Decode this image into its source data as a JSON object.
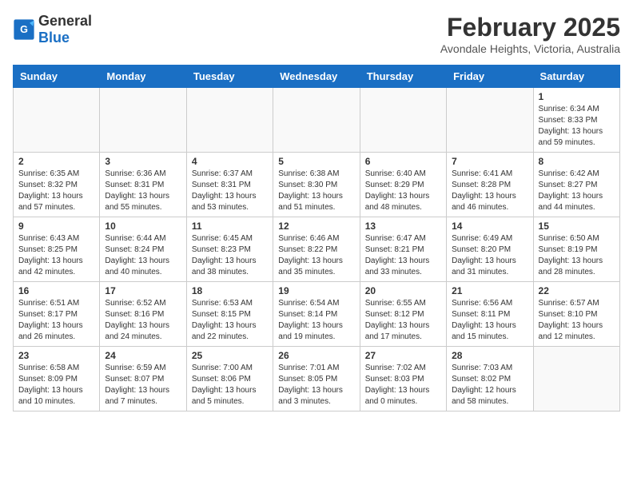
{
  "header": {
    "logo_general": "General",
    "logo_blue": "Blue",
    "month": "February 2025",
    "location": "Avondale Heights, Victoria, Australia"
  },
  "weekdays": [
    "Sunday",
    "Monday",
    "Tuesday",
    "Wednesday",
    "Thursday",
    "Friday",
    "Saturday"
  ],
  "weeks": [
    [
      {
        "day": "",
        "info": ""
      },
      {
        "day": "",
        "info": ""
      },
      {
        "day": "",
        "info": ""
      },
      {
        "day": "",
        "info": ""
      },
      {
        "day": "",
        "info": ""
      },
      {
        "day": "",
        "info": ""
      },
      {
        "day": "1",
        "info": "Sunrise: 6:34 AM\nSunset: 8:33 PM\nDaylight: 13 hours and 59 minutes."
      }
    ],
    [
      {
        "day": "2",
        "info": "Sunrise: 6:35 AM\nSunset: 8:32 PM\nDaylight: 13 hours and 57 minutes."
      },
      {
        "day": "3",
        "info": "Sunrise: 6:36 AM\nSunset: 8:31 PM\nDaylight: 13 hours and 55 minutes."
      },
      {
        "day": "4",
        "info": "Sunrise: 6:37 AM\nSunset: 8:31 PM\nDaylight: 13 hours and 53 minutes."
      },
      {
        "day": "5",
        "info": "Sunrise: 6:38 AM\nSunset: 8:30 PM\nDaylight: 13 hours and 51 minutes."
      },
      {
        "day": "6",
        "info": "Sunrise: 6:40 AM\nSunset: 8:29 PM\nDaylight: 13 hours and 48 minutes."
      },
      {
        "day": "7",
        "info": "Sunrise: 6:41 AM\nSunset: 8:28 PM\nDaylight: 13 hours and 46 minutes."
      },
      {
        "day": "8",
        "info": "Sunrise: 6:42 AM\nSunset: 8:27 PM\nDaylight: 13 hours and 44 minutes."
      }
    ],
    [
      {
        "day": "9",
        "info": "Sunrise: 6:43 AM\nSunset: 8:25 PM\nDaylight: 13 hours and 42 minutes."
      },
      {
        "day": "10",
        "info": "Sunrise: 6:44 AM\nSunset: 8:24 PM\nDaylight: 13 hours and 40 minutes."
      },
      {
        "day": "11",
        "info": "Sunrise: 6:45 AM\nSunset: 8:23 PM\nDaylight: 13 hours and 38 minutes."
      },
      {
        "day": "12",
        "info": "Sunrise: 6:46 AM\nSunset: 8:22 PM\nDaylight: 13 hours and 35 minutes."
      },
      {
        "day": "13",
        "info": "Sunrise: 6:47 AM\nSunset: 8:21 PM\nDaylight: 13 hours and 33 minutes."
      },
      {
        "day": "14",
        "info": "Sunrise: 6:49 AM\nSunset: 8:20 PM\nDaylight: 13 hours and 31 minutes."
      },
      {
        "day": "15",
        "info": "Sunrise: 6:50 AM\nSunset: 8:19 PM\nDaylight: 13 hours and 28 minutes."
      }
    ],
    [
      {
        "day": "16",
        "info": "Sunrise: 6:51 AM\nSunset: 8:17 PM\nDaylight: 13 hours and 26 minutes."
      },
      {
        "day": "17",
        "info": "Sunrise: 6:52 AM\nSunset: 8:16 PM\nDaylight: 13 hours and 24 minutes."
      },
      {
        "day": "18",
        "info": "Sunrise: 6:53 AM\nSunset: 8:15 PM\nDaylight: 13 hours and 22 minutes."
      },
      {
        "day": "19",
        "info": "Sunrise: 6:54 AM\nSunset: 8:14 PM\nDaylight: 13 hours and 19 minutes."
      },
      {
        "day": "20",
        "info": "Sunrise: 6:55 AM\nSunset: 8:12 PM\nDaylight: 13 hours and 17 minutes."
      },
      {
        "day": "21",
        "info": "Sunrise: 6:56 AM\nSunset: 8:11 PM\nDaylight: 13 hours and 15 minutes."
      },
      {
        "day": "22",
        "info": "Sunrise: 6:57 AM\nSunset: 8:10 PM\nDaylight: 13 hours and 12 minutes."
      }
    ],
    [
      {
        "day": "23",
        "info": "Sunrise: 6:58 AM\nSunset: 8:09 PM\nDaylight: 13 hours and 10 minutes."
      },
      {
        "day": "24",
        "info": "Sunrise: 6:59 AM\nSunset: 8:07 PM\nDaylight: 13 hours and 7 minutes."
      },
      {
        "day": "25",
        "info": "Sunrise: 7:00 AM\nSunset: 8:06 PM\nDaylight: 13 hours and 5 minutes."
      },
      {
        "day": "26",
        "info": "Sunrise: 7:01 AM\nSunset: 8:05 PM\nDaylight: 13 hours and 3 minutes."
      },
      {
        "day": "27",
        "info": "Sunrise: 7:02 AM\nSunset: 8:03 PM\nDaylight: 13 hours and 0 minutes."
      },
      {
        "day": "28",
        "info": "Sunrise: 7:03 AM\nSunset: 8:02 PM\nDaylight: 12 hours and 58 minutes."
      },
      {
        "day": "",
        "info": ""
      }
    ]
  ]
}
